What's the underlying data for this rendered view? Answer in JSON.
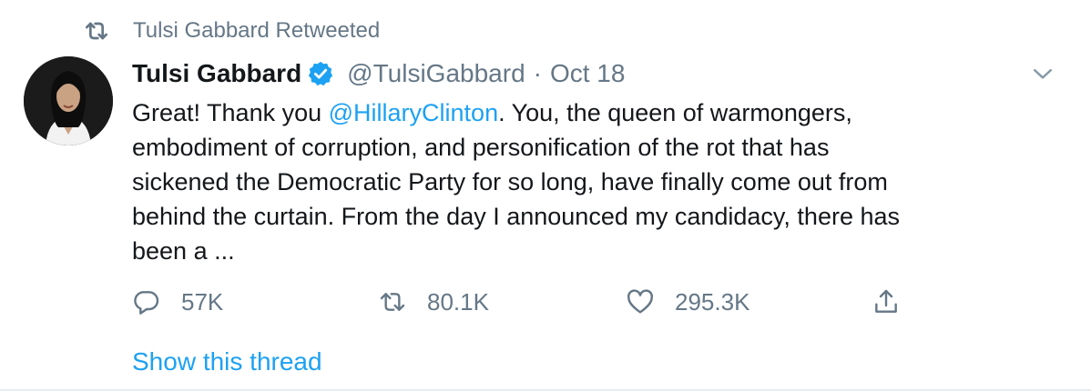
{
  "retweet": {
    "icon": "retweet-icon",
    "text": "Tulsi Gabbard Retweeted"
  },
  "author": {
    "avatar_icon": "avatar-photo",
    "name": "Tulsi Gabbard",
    "verified_icon": "verified-badge-icon",
    "handle": "@TulsiGabbard",
    "separator": "·",
    "date": "Oct 18"
  },
  "menu": {
    "icon": "chevron-down-icon"
  },
  "tweet": {
    "text_before_mention": "Great! Thank you ",
    "mention": "@HillaryClinton",
    "text_after_mention": ". You, the queen of warmongers,",
    "line2": "embodiment of corruption, and personification of the rot that has",
    "line3": "sickened the Democratic Party for so long, have finally come out from",
    "line4": "behind the curtain. From the day I announced my candidacy, there has",
    "line5": "been a ..."
  },
  "actions": {
    "reply": {
      "icon": "reply-icon",
      "count": "57K"
    },
    "retweet": {
      "icon": "retweet-icon",
      "count": "80.1K"
    },
    "like": {
      "icon": "heart-icon",
      "count": "295.3K"
    },
    "share": {
      "icon": "share-icon"
    }
  },
  "show_thread": "Show this thread",
  "colors": {
    "accent": "#1da1f2",
    "muted": "#657786",
    "text": "#14171a",
    "divider": "#e6ecf0"
  }
}
